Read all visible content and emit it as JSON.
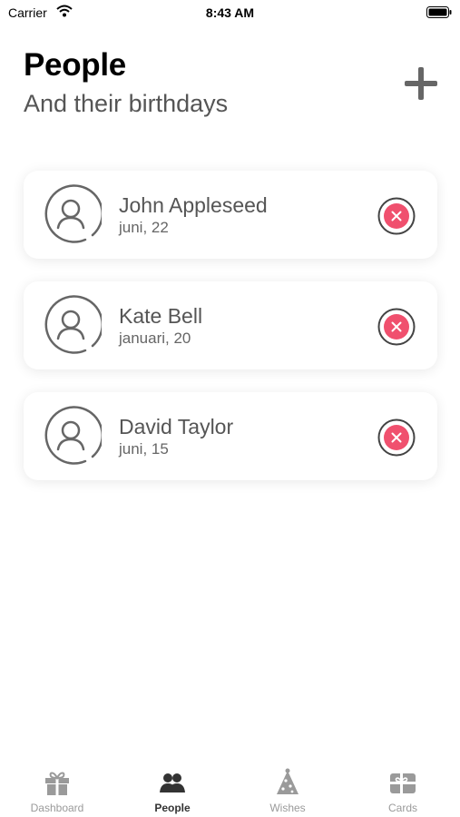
{
  "status_bar": {
    "carrier": "Carrier",
    "time": "8:43 AM"
  },
  "header": {
    "title": "People",
    "subtitle": "And their birthdays"
  },
  "people": [
    {
      "name": "John Appleseed",
      "birthday": "juni, 22"
    },
    {
      "name": "Kate Bell",
      "birthday": "januari, 20"
    },
    {
      "name": "David Taylor",
      "birthday": "juni, 15"
    }
  ],
  "tabs": [
    {
      "label": "Dashboard",
      "icon": "gift-icon",
      "active": false
    },
    {
      "label": "People",
      "icon": "people-icon",
      "active": true
    },
    {
      "label": "Wishes",
      "icon": "party-hat-icon",
      "active": false
    },
    {
      "label": "Cards",
      "icon": "gift-card-icon",
      "active": false
    }
  ],
  "colors": {
    "delete_accent": "#f0506e",
    "icon_gray": "#666666",
    "active_tab": "#333333",
    "inactive_tab": "#9a9a9a"
  }
}
